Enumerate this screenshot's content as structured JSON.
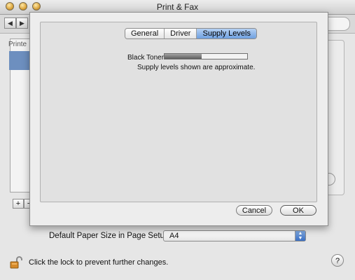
{
  "window": {
    "title": "Print & Fax"
  },
  "sidebar": {
    "header": "Printe"
  },
  "sheet": {
    "tabs": [
      {
        "label": "General"
      },
      {
        "label": "Driver"
      },
      {
        "label": "Supply Levels"
      }
    ],
    "supply": {
      "name": "Black Toner",
      "level_fraction": 0.45,
      "note": "Supply levels shown are approximate."
    },
    "buttons": {
      "cancel": "Cancel",
      "ok": "OK"
    }
  },
  "settings": {
    "paper_size_label": "Default Paper Size in Page Setup:",
    "paper_size_value": "A4"
  },
  "lock": {
    "text": "Click the lock to prevent further changes."
  },
  "help": {
    "label": "?"
  },
  "colors": {
    "accent": "#6fa0e0",
    "selection": "#6d8fbf"
  }
}
